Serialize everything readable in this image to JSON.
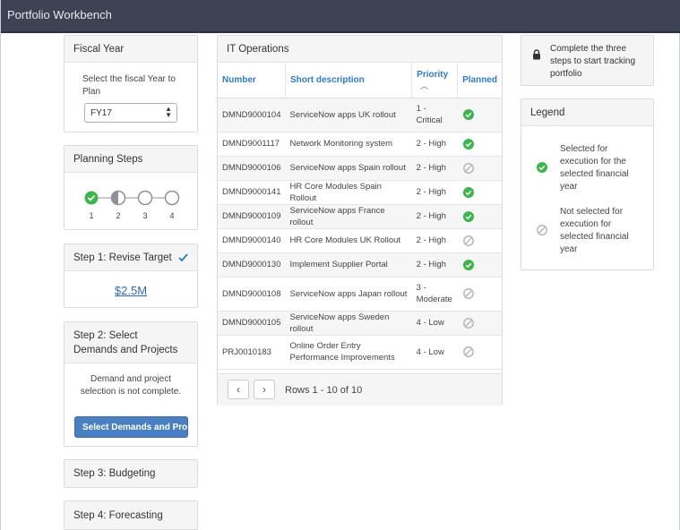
{
  "app": {
    "title": "Portfolio Workbench"
  },
  "fiscal_year": {
    "header": "Fiscal Year",
    "prompt": "Select the fiscal Year to Plan",
    "selected": "FY17"
  },
  "planning_steps": {
    "header": "Planning Steps",
    "steps": [
      {
        "label": "1",
        "state": "complete"
      },
      {
        "label": "2",
        "state": "in-progress"
      },
      {
        "label": "3",
        "state": "pending"
      },
      {
        "label": "4",
        "state": "pending"
      }
    ]
  },
  "step1": {
    "header": "Step 1: Revise Target",
    "amount": "$2.5M"
  },
  "step2": {
    "header": "Step 2: Select Demands and Projects",
    "message": "Demand and project selection is not complete.",
    "button_label": "Select Demands and Projects"
  },
  "step3": {
    "header": "Step 3: Budgeting"
  },
  "step4": {
    "header": "Step 4: Forecasting"
  },
  "it_operations": {
    "header": "IT Operations",
    "columns": {
      "number": "Number",
      "short_description": "Short description",
      "priority": "Priority",
      "planned": "Planned"
    },
    "rows": [
      {
        "number": "DMND9000104",
        "description": "ServiceNow apps UK rollout",
        "priority": "1 - Critical",
        "planned": true
      },
      {
        "number": "DMND9001117",
        "description": "Network Monitoring system",
        "priority": "2 - High",
        "planned": true
      },
      {
        "number": "DMND9000106",
        "description": "ServiceNow apps Spain rollout",
        "priority": "2 - High",
        "planned": false
      },
      {
        "number": "DMND9000141",
        "description": "HR Core Modules Spain Rollout",
        "priority": "2 - High",
        "planned": true
      },
      {
        "number": "DMND9000109",
        "description": "ServiceNow apps France rollout",
        "priority": "2 - High",
        "planned": true
      },
      {
        "number": "DMND9000140",
        "description": "HR Core Modules UK Rollout",
        "priority": "2 - High",
        "planned": false
      },
      {
        "number": "DMND9000130",
        "description": "Implement Supplier Portal",
        "priority": "2 - High",
        "planned": true
      },
      {
        "number": "DMND9000108",
        "description": "ServiceNow apps Japan rollout",
        "priority": "3 - Moderate",
        "planned": false
      },
      {
        "number": "DMND9000105",
        "description": "ServiceNow apps Sweden rollout",
        "priority": "4 - Low",
        "planned": false
      },
      {
        "number": "PRJ0010183",
        "description": "Online Order Entry Performance Improvements",
        "priority": "4 - Low",
        "planned": false
      }
    ],
    "pager_text": "Rows 1 - 10 of 10"
  },
  "notice": {
    "text": "Complete the three steps to start tracking portfolio"
  },
  "legend": {
    "header": "Legend",
    "selected_text": "Selected for execution for the selected financial year",
    "not_selected_text": "Not selected for execution for selected financial year"
  },
  "colors": {
    "green": "#3cb54a",
    "grey": "#b5b8bd",
    "blue": "#2f7bc4",
    "header": "#3b4354"
  }
}
